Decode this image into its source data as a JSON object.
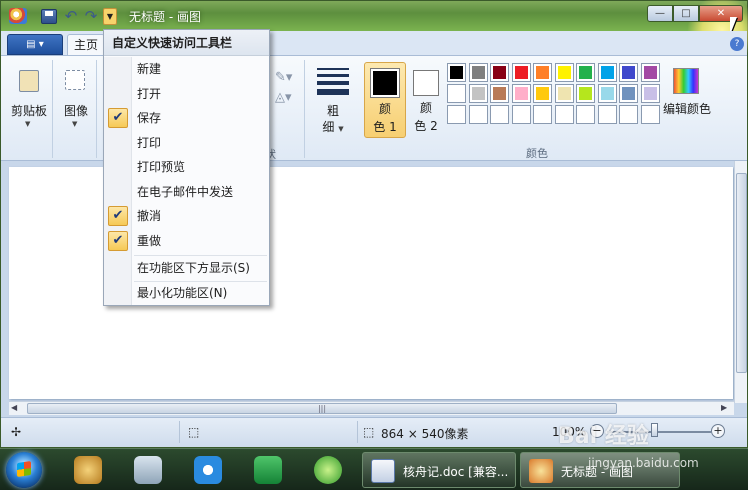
{
  "window": {
    "title": "无标题 - 画图"
  },
  "tabs": {
    "paint_menu": "▤ ▾",
    "home": "主页"
  },
  "ribbon": {
    "clipboard_label": "剪贴板",
    "image_label": "图像",
    "shapes_label": "状",
    "size_label_1": "粗",
    "size_label_2": "细",
    "color1_label_1": "颜",
    "color1_label_2": "色 1",
    "color2_label_1": "颜",
    "color2_label_2": "色 2",
    "colors_group_label": "颜色",
    "edit_colors_label": "编辑颜色",
    "color1": "#000000",
    "color2": "#ffffff",
    "palette_row1": [
      "#000000",
      "#7f7f7f",
      "#880015",
      "#ed1c24",
      "#ff7f27",
      "#fff200",
      "#22b14c",
      "#00a2e8",
      "#3f48cc",
      "#a349a4"
    ],
    "palette_row2": [
      "#ffffff",
      "#c3c3c3",
      "#b97a57",
      "#ffaec9",
      "#ffc90e",
      "#efe4b0",
      "#b5e61d",
      "#99d9ea",
      "#7092be",
      "#c8bfe7"
    ],
    "palette_row3": [
      "#ffffff",
      "#ffffff",
      "#ffffff",
      "#ffffff",
      "#ffffff",
      "#ffffff",
      "#ffffff",
      "#ffffff",
      "#ffffff",
      "#ffffff"
    ]
  },
  "qat_menu": {
    "title": "自定义快速访问工具栏",
    "items": [
      {
        "label": "新建",
        "checked": false
      },
      {
        "label": "打开",
        "checked": false
      },
      {
        "label": "保存",
        "checked": true
      },
      {
        "label": "打印",
        "checked": false
      },
      {
        "label": "打印预览",
        "checked": false
      },
      {
        "label": "在电子邮件中发送",
        "checked": false
      },
      {
        "label": "撤消",
        "checked": true
      },
      {
        "label": "重做",
        "checked": true
      }
    ],
    "show_below": "在功能区下方显示(S)",
    "minimize": "最小化功能区(N)"
  },
  "status": {
    "canvas_size": "864 × 540像素",
    "zoom": "100%"
  },
  "taskbar": {
    "tasks": [
      {
        "label": "核舟记.doc [兼容..."
      },
      {
        "label": "无标题 - 画图"
      }
    ]
  },
  "watermark": {
    "text": "Bai 经验",
    "sub": "jingyan.baidu.com"
  }
}
